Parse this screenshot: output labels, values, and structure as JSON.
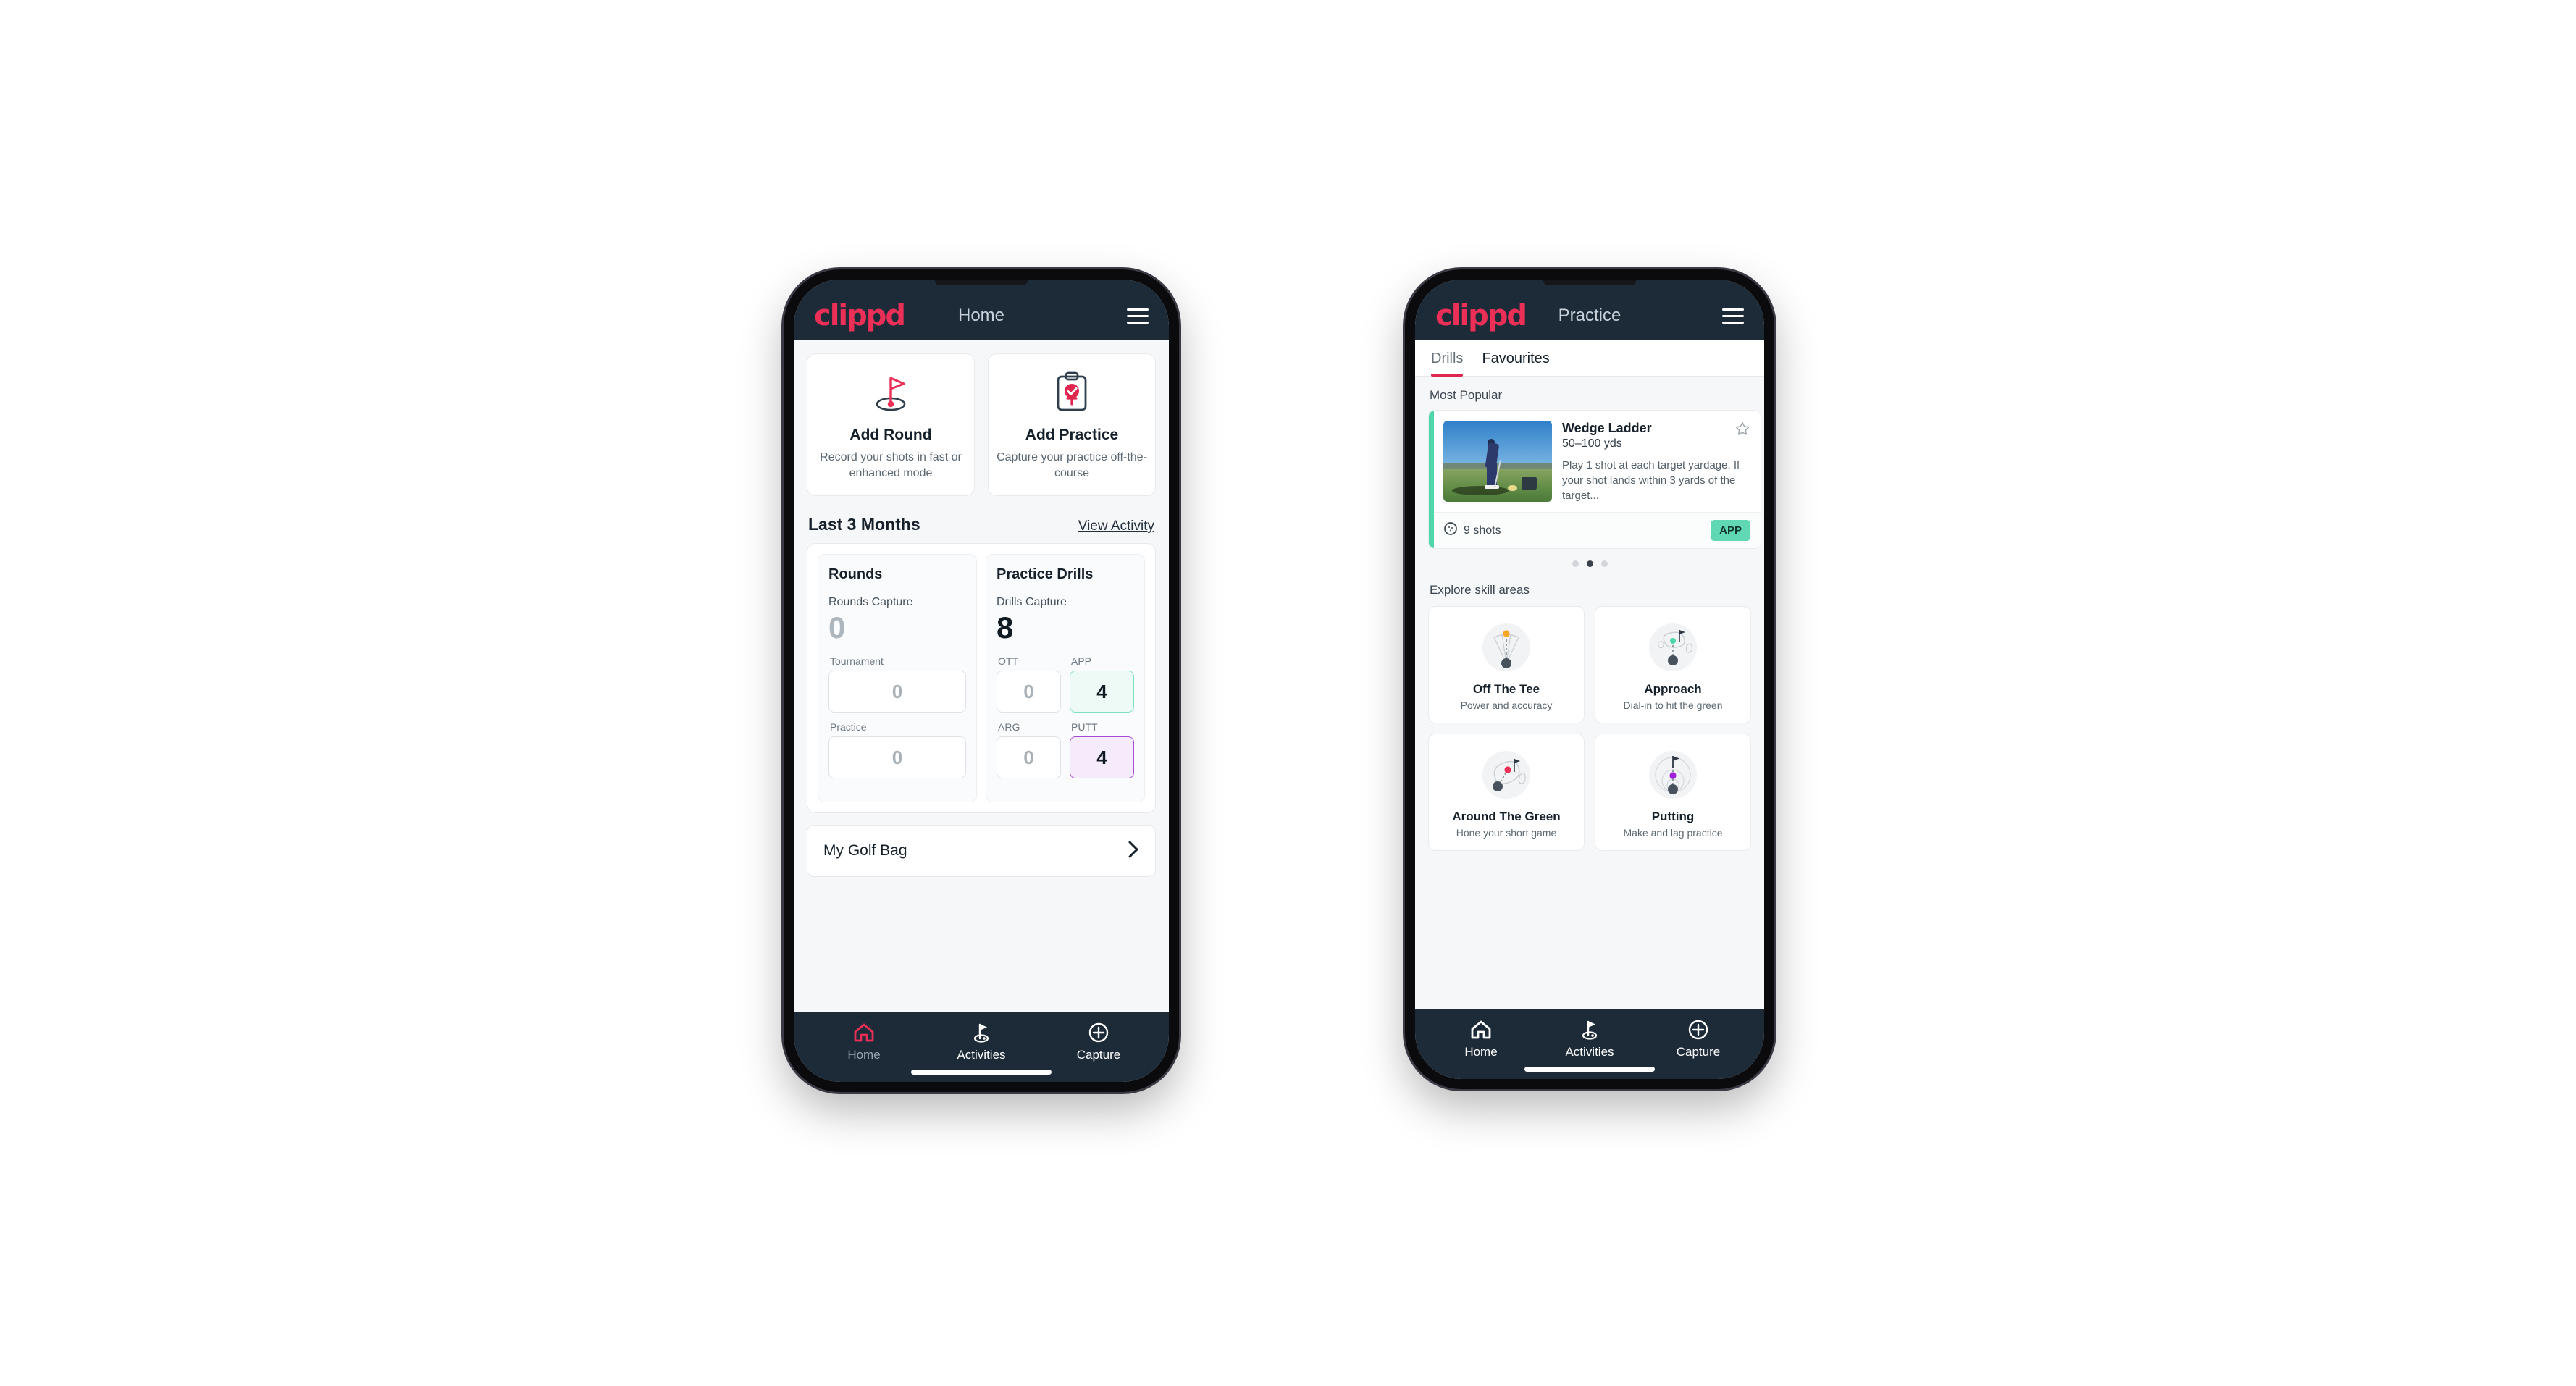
{
  "brand": {
    "logo_text": "clippd",
    "accent_pink": "#ec2f57",
    "dark_navy": "#1d2b38",
    "teal": "#5fd8b3",
    "purple": "#a020d8"
  },
  "home_phone": {
    "appbar": {
      "title": "Home",
      "menu_icon": "hamburger-icon"
    },
    "quick_actions": [
      {
        "icon": "golf-flag-icon",
        "title": "Add Round",
        "subtitle": "Record your shots in fast or enhanced mode"
      },
      {
        "icon": "clipboard-check-icon",
        "title": "Add Practice",
        "subtitle": "Capture your practice off-the-course"
      }
    ],
    "section": {
      "title": "Last 3 Months",
      "link": "View Activity"
    },
    "stats": {
      "rounds": {
        "heading": "Rounds",
        "capture_label": "Rounds Capture",
        "capture_value": "0",
        "rows": [
          {
            "label": "Tournament",
            "value": "0",
            "highlight": "none"
          },
          {
            "label": "Practice",
            "value": "0",
            "highlight": "none"
          }
        ]
      },
      "drills": {
        "heading": "Practice Drills",
        "capture_label": "Drills Capture",
        "capture_value": "8",
        "grid": [
          {
            "label": "OTT",
            "value": "0",
            "highlight": "none"
          },
          {
            "label": "APP",
            "value": "4",
            "highlight": "teal"
          },
          {
            "label": "ARG",
            "value": "0",
            "highlight": "none"
          },
          {
            "label": "PUTT",
            "value": "4",
            "highlight": "purple"
          }
        ]
      }
    },
    "golf_bag": {
      "label": "My Golf Bag",
      "chevron": "chevron-right-icon"
    },
    "bottom_nav": [
      {
        "label": "Home",
        "icon": "house-icon",
        "active": true
      },
      {
        "label": "Activities",
        "icon": "golf-flag-icon",
        "active": false
      },
      {
        "label": "Capture",
        "icon": "plus-circle-icon",
        "active": false
      }
    ]
  },
  "practice_phone": {
    "appbar": {
      "title": "Practice",
      "menu_icon": "hamburger-icon"
    },
    "tabs": [
      {
        "label": "Drills",
        "active": true
      },
      {
        "label": "Favourites",
        "active": false
      }
    ],
    "most_popular_label": "Most Popular",
    "drill_card": {
      "accent_color": "#4fd6ab",
      "title": "Wedge Ladder",
      "yardage": "50–100 yds",
      "description": "Play 1 shot at each target yardage. If your shot lands within 3 yards of the target...",
      "shots": "9 shots",
      "shots_icon": "golf-ball-icon",
      "badge": "APP",
      "star_icon": "star-outline-icon",
      "thumbnail_alt": "golfer-hitting-wedge-photo"
    },
    "next_card_accent": "#a020d8",
    "carousel_dots": {
      "count": 3,
      "active_index": 1
    },
    "explore_label": "Explore skill areas",
    "skill_areas": [
      {
        "title": "Off The Tee",
        "subtitle": "Power and accuracy",
        "icon": "tee-fan-icon",
        "dot_color": "#f5a623"
      },
      {
        "title": "Approach",
        "subtitle": "Dial-in to hit the green",
        "icon": "green-approach-icon",
        "dot_color": "#4fd6ab"
      },
      {
        "title": "Around The Green",
        "subtitle": "Hone your short game",
        "icon": "chip-green-icon",
        "dot_color": "#ec2f57"
      },
      {
        "title": "Putting",
        "subtitle": "Make and lag practice",
        "icon": "putting-rings-icon",
        "dot_color": "#a020d8"
      }
    ],
    "bottom_nav": [
      {
        "label": "Home",
        "icon": "house-icon",
        "active": false
      },
      {
        "label": "Activities",
        "icon": "golf-flag-icon",
        "active": true
      },
      {
        "label": "Capture",
        "icon": "plus-circle-icon",
        "active": false
      }
    ]
  }
}
